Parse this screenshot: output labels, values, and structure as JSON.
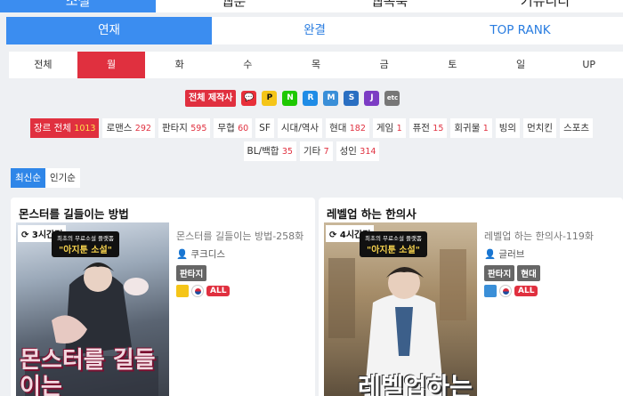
{
  "top_nav": [
    "소설",
    "웹툰",
    "웹폭툭",
    "커뮤니티"
  ],
  "sub_tabs": [
    "연재",
    "완결",
    "TOP RANK"
  ],
  "days": [
    "전체",
    "월",
    "화",
    "수",
    "목",
    "금",
    "토",
    "일",
    "UP"
  ],
  "platforms_label": "전체 제작사",
  "platform_icons": [
    {
      "name": "kakaopage-icon",
      "color": "#e8303a",
      "glyph": "💬"
    },
    {
      "name": "munpia-icon",
      "color": "#f5c518",
      "glyph": "P"
    },
    {
      "name": "naver-icon",
      "color": "#1ec800",
      "glyph": "N"
    },
    {
      "name": "ridi-icon",
      "color": "#1f8ce6",
      "glyph": "R"
    },
    {
      "name": "mrblue-icon",
      "color": "#3a8fd8",
      "glyph": "M"
    },
    {
      "name": "series-icon",
      "color": "#2a6fc2",
      "glyph": "S"
    },
    {
      "name": "joara-icon",
      "color": "#7c3cc4",
      "glyph": "J"
    },
    {
      "name": "etc-icon",
      "color": "#777777",
      "glyph": "etc"
    }
  ],
  "genres": [
    {
      "label": "장르 전체",
      "count": "1013"
    },
    {
      "label": "로맨스",
      "count": "292"
    },
    {
      "label": "판타지",
      "count": "595"
    },
    {
      "label": "무협",
      "count": "60"
    },
    {
      "label": "SF",
      "count": ""
    },
    {
      "label": "시대/역사",
      "count": ""
    },
    {
      "label": "현대",
      "count": "182"
    },
    {
      "label": "게임",
      "count": "1"
    },
    {
      "label": "퓨전",
      "count": "15"
    },
    {
      "label": "회귀물",
      "count": "1"
    },
    {
      "label": "빙의",
      "count": ""
    },
    {
      "label": "먼치킨",
      "count": ""
    },
    {
      "label": "스포츠",
      "count": ""
    },
    {
      "label": "BL/백합",
      "count": "35"
    },
    {
      "label": "기타",
      "count": "7"
    },
    {
      "label": "성인",
      "count": "314"
    }
  ],
  "sort": [
    "최신순",
    "인기순"
  ],
  "cards": [
    {
      "title": "몬스터를 길들이는 방법",
      "time": "3시간전",
      "banner_small": "최초의 무료소설 플랫폼",
      "banner_big": "\"아지툰 소설\"",
      "cover_text": "몬스터를 길들이는",
      "episode": "몬스터를 길들이는 방법-258화",
      "author": "쿠크디스",
      "tags": [
        "판타지"
      ],
      "platform_color": "#f5c518",
      "rating": "ALL"
    },
    {
      "title": "레벨업 하는 한의사",
      "time": "4시간전",
      "banner_small": "최초의 무료소설 플랫폼",
      "banner_big": "\"아지툰 소설\"",
      "cover_text": "레벨업하는",
      "episode": "레벨업 하는 한의사-119화",
      "author": "글러브",
      "tags": [
        "판타지",
        "현대"
      ],
      "platform_color": "#3a8fd8",
      "rating": "ALL"
    }
  ]
}
